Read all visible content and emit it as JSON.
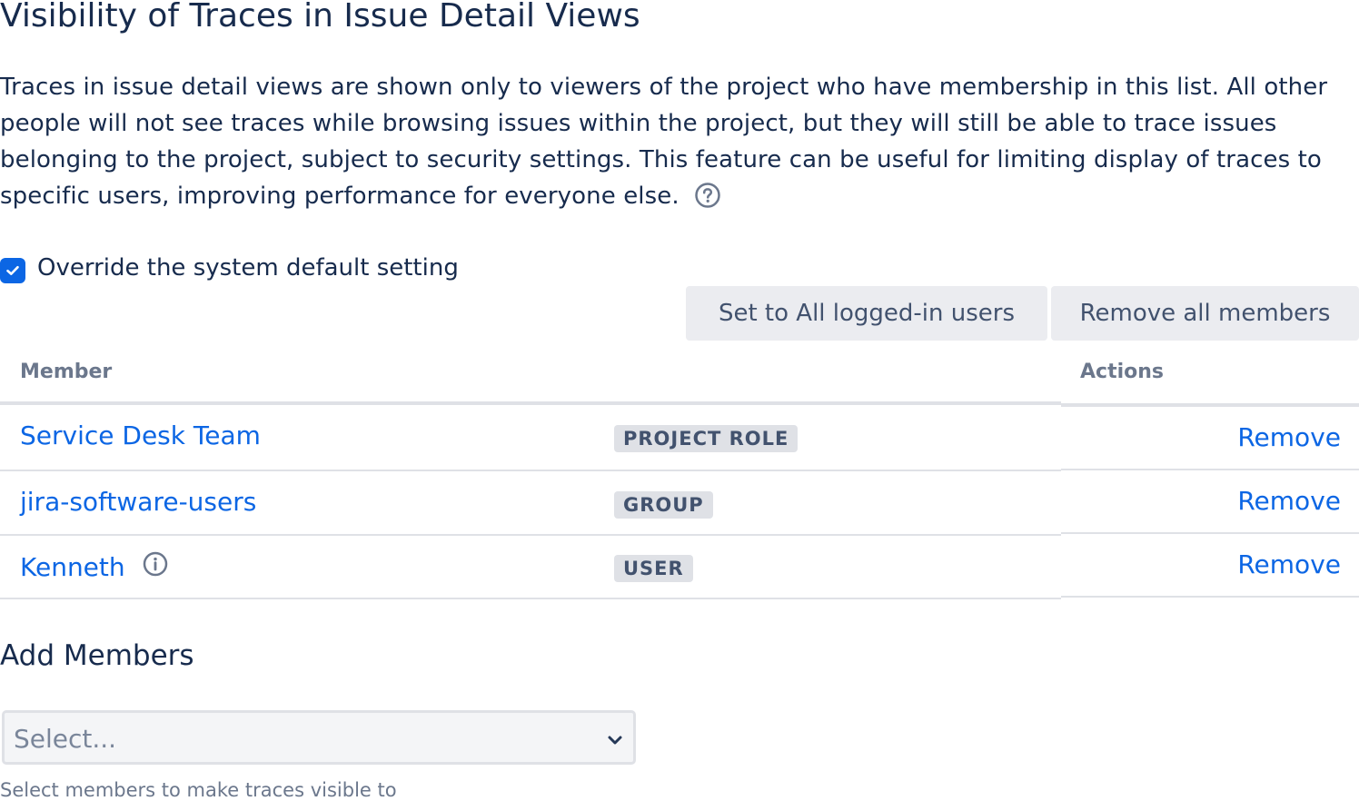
{
  "page": {
    "title": "Visibility of Traces in Issue Detail Views",
    "description": "Traces in issue detail views are shown only to viewers of the project who have membership in this list. All other people will not see traces while browsing issues within the project, but they will still be able to trace issues belonging to the project, subject to security settings. This feature can be useful for limiting display of traces to specific users, improving performance for everyone else."
  },
  "override": {
    "label": "Override the system default setting",
    "checked": true
  },
  "buttons": {
    "set_all": "Set to All logged-in users",
    "remove_all": "Remove all members"
  },
  "table": {
    "headers": {
      "member": "Member",
      "actions": "Actions"
    },
    "rows": [
      {
        "name": "Service Desk Team",
        "type": "PROJECT ROLE",
        "action": "Remove"
      },
      {
        "name": "jira-software-users",
        "type": "GROUP",
        "action": "Remove"
      },
      {
        "name": "Kenneth",
        "type": "USER",
        "action": "Remove"
      }
    ]
  },
  "add_members": {
    "title": "Add Members",
    "placeholder": "Select...",
    "helper": "Select members to make traces visible to"
  },
  "icons": {
    "help": "help-icon",
    "info": "info-icon",
    "check": "check-icon",
    "chevron": "chevron-down-icon"
  },
  "colors": {
    "link": "#0c66e4",
    "checkbox": "#0c66e4",
    "heading": "#172b4d"
  }
}
